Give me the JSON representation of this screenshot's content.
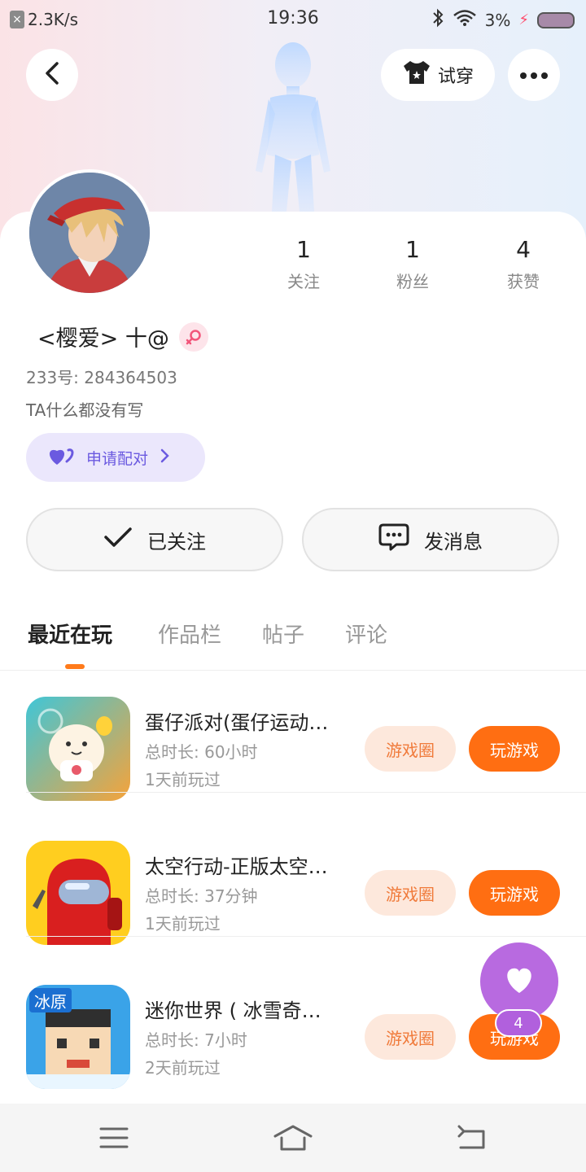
{
  "status_bar": {
    "net_speed": "2.3K/s",
    "time": "19:36",
    "battery": "3%"
  },
  "header": {
    "try_on_label": "试穿"
  },
  "profile": {
    "username": "<樱爱> 十@",
    "uid": "233号: 284364503",
    "bio": "TA什么都没有写",
    "pair_label": "申请配对",
    "stats": [
      {
        "value": "1",
        "label": "关注"
      },
      {
        "value": "1",
        "label": "粉丝"
      },
      {
        "value": "4",
        "label": "获赞"
      }
    ]
  },
  "actions": {
    "followed_label": "已关注",
    "message_label": "发消息"
  },
  "tabs": [
    {
      "label": "最近在玩",
      "active": true
    },
    {
      "label": "作品栏",
      "active": false
    },
    {
      "label": "帖子",
      "active": false
    },
    {
      "label": "评论",
      "active": false
    }
  ],
  "games": [
    {
      "title": "蛋仔派对(蛋仔运动…",
      "total_time": "总时长: 60小时",
      "last_played": "1天前玩过",
      "circle_label": "游戏圈",
      "play_label": "玩游戏"
    },
    {
      "title": "太空行动-正版太空…",
      "total_time": "总时长: 37分钟",
      "last_played": "1天前玩过",
      "circle_label": "游戏圈",
      "play_label": "玩游戏"
    },
    {
      "title": "迷你世界 ( 冰雪奇…",
      "total_time": "总时长: 7小时",
      "last_played": "2天前玩过",
      "circle_label": "游戏圈",
      "play_label": "玩游戏"
    }
  ],
  "game_icon_texts": {
    "mini_world_badge": "冰原"
  },
  "like_fab": {
    "count": "4"
  },
  "colors": {
    "accent_orange": "#ff6e12",
    "pair_purple": "#6b5ae0",
    "fab_purple": "#b86ae0"
  }
}
